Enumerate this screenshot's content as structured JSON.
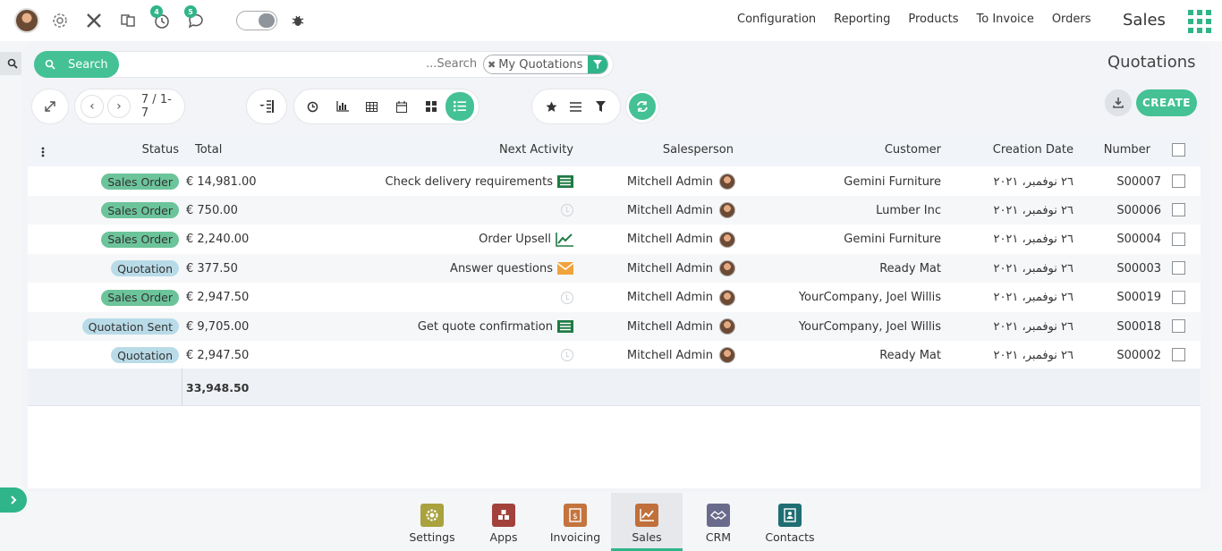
{
  "topbar": {
    "badges": {
      "activities": "4",
      "messages": "5"
    },
    "menu": [
      "Configuration",
      "Reporting",
      "Products",
      "To Invoice",
      "Orders"
    ],
    "app_title": "Sales"
  },
  "control": {
    "search_label": "Search",
    "search_placeholder": "...Search",
    "facet_label": "My Quotations",
    "page_title": "Quotations",
    "pager": "7 / 1-7",
    "create_label": "CREATE"
  },
  "table": {
    "headers": {
      "status": "Status",
      "total": "Total",
      "activity": "Next Activity",
      "salesperson": "Salesperson",
      "customer": "Customer",
      "date": "Creation Date",
      "number": "Number"
    },
    "rows": [
      {
        "status": "Sales Order",
        "status_type": "order",
        "total": "€ 14,981.00",
        "activity": "Check delivery requirements",
        "activity_icon": "list-icon",
        "salesperson": "Mitchell Admin",
        "customer": "Gemini Furniture",
        "date": "٢٦ نوفمبر، ٢٠٢١",
        "number": "S00007"
      },
      {
        "status": "Sales Order",
        "status_type": "order",
        "total": "€ 750.00",
        "activity": "",
        "activity_icon": "clock-icon",
        "salesperson": "Mitchell Admin",
        "customer": "Lumber Inc",
        "date": "٢٦ نوفمبر، ٢٠٢١",
        "number": "S00006"
      },
      {
        "status": "Sales Order",
        "status_type": "order",
        "total": "€ 2,240.00",
        "activity": "Order Upsell",
        "activity_icon": "chart-icon",
        "salesperson": "Mitchell Admin",
        "customer": "Gemini Furniture",
        "date": "٢٦ نوفمبر، ٢٠٢١",
        "number": "S00004"
      },
      {
        "status": "Quotation",
        "status_type": "quote",
        "total": "€ 377.50",
        "activity": "Answer questions",
        "activity_icon": "envelope-icon",
        "salesperson": "Mitchell Admin",
        "customer": "Ready Mat",
        "date": "٢٦ نوفمبر، ٢٠٢١",
        "number": "S00003"
      },
      {
        "status": "Sales Order",
        "status_type": "order",
        "total": "€ 2,947.50",
        "activity": "",
        "activity_icon": "clock-icon",
        "salesperson": "Mitchell Admin",
        "customer": "YourCompany, Joel Willis",
        "date": "٢٦ نوفمبر، ٢٠٢١",
        "number": "S00019"
      },
      {
        "status": "Quotation Sent",
        "status_type": "quote",
        "total": "€ 9,705.00",
        "activity": "Get quote confirmation",
        "activity_icon": "list-icon",
        "salesperson": "Mitchell Admin",
        "customer": "YourCompany, Joel Willis",
        "date": "٢٦ نوفمبر، ٢٠٢١",
        "number": "S00018"
      },
      {
        "status": "Quotation",
        "status_type": "quote",
        "total": "€ 2,947.50",
        "activity": "",
        "activity_icon": "clock-icon",
        "salesperson": "Mitchell Admin",
        "customer": "Ready Mat",
        "date": "٢٦ نوفمبر، ٢٠٢١",
        "number": "S00002"
      }
    ],
    "sum_total": "33,948.50"
  },
  "dock": [
    {
      "label": "Settings",
      "color": "#a9a23e",
      "active": false
    },
    {
      "label": "Apps",
      "color": "#a3423c",
      "active": false
    },
    {
      "label": "Invoicing",
      "color": "#c4743e",
      "active": false
    },
    {
      "label": "Sales",
      "color": "#c0703b",
      "active": true
    },
    {
      "label": "CRM",
      "color": "#6a6b8c",
      "active": false
    },
    {
      "label": "Contacts",
      "color": "#1f6e73",
      "active": false
    }
  ],
  "colors": {
    "accent": "#44c195",
    "order_badge": "#6cc49b",
    "quote_badge": "#b9dbe8"
  }
}
